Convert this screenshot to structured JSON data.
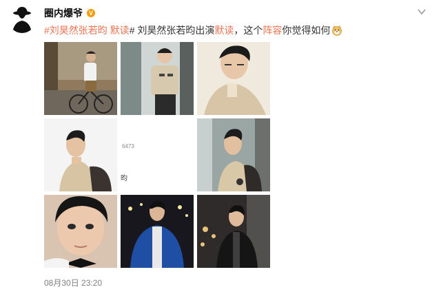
{
  "post": {
    "author": "圈内爆爷",
    "badge": "V",
    "text_parts": [
      {
        "text": "#刘昊然张若昀 ",
        "style": "topic"
      },
      {
        "text": "默读",
        "style": "hl"
      },
      {
        "text": "# 刘昊然张若昀出演",
        "style": "normal"
      },
      {
        "text": "默读",
        "style": "hl"
      },
      {
        "text": "，这个",
        "style": "normal"
      },
      {
        "text": "阵容",
        "style": "hl"
      },
      {
        "text": "你觉得如何",
        "style": "normal"
      }
    ],
    "emoji": "doge-emoji",
    "timestamp": "08月30日 23:20"
  },
  "photos": [
    {
      "name": "photo-bicycle-street"
    },
    {
      "name": "photo-beige-shirt-window"
    },
    {
      "name": "photo-beige-shirt-closeup"
    },
    {
      "name": "photo-backpack-side-profile"
    },
    {
      "name": "photo-blank-loading",
      "ghost_a": "6473",
      "ghost_b": "昀"
    },
    {
      "name": "photo-backpack-window"
    },
    {
      "name": "photo-bowtie-portrait"
    },
    {
      "name": "photo-blue-jacket-night"
    },
    {
      "name": "photo-black-jacket-night"
    }
  ],
  "colors": {
    "topic": "#eb7350",
    "text": "#333333",
    "time": "#808080",
    "badge": "#f59a00"
  }
}
